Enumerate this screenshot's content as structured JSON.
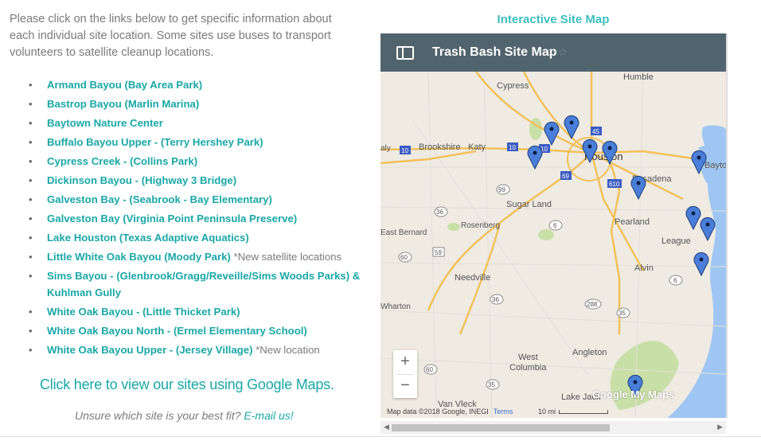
{
  "intro_text": "Please click on the links below to get specific information about each individual site location. Some sites use buses to transport volunteers to satellite cleanup locations.",
  "sites": [
    {
      "label": " Armand Bayou (Bay Area Park)",
      "note": ""
    },
    {
      "label": " Bastrop Bayou (Marlin Marina)",
      "note": ""
    },
    {
      "label": "Baytown Nature Center",
      "note": ""
    },
    {
      "label": "Buffalo Bayou Upper - (Terry Hershey Park)",
      "note": ""
    },
    {
      "label": "Cypress Creek - (Collins Park)",
      "note": ""
    },
    {
      "label": "Dickinson Bayou - (Highway 3 Bridge)",
      "note": ""
    },
    {
      "label": " Galveston Bay - (Seabrook - Bay Elementary)",
      "note": ""
    },
    {
      "label": "Galveston Bay (Virginia Point Peninsula Preserve)",
      "note": ""
    },
    {
      "label": "Lake Houston (Texas Adaptive Aquatics)",
      "note": ""
    },
    {
      "label": "Little White Oak Bayou (Moody Park)",
      "note": " *New satellite locations"
    },
    {
      "label": "Sims Bayou - (Glenbrook/Gragg/Reveille/Sims Woods Parks) & Kuhlman Gully",
      "note": ""
    },
    {
      "label": "White Oak Bayou - (Little Thicket Park)",
      "note": ""
    },
    {
      "label": "White Oak Bayou North - (Ermel Elementary School)",
      "note": ""
    },
    {
      "label": "White Oak Bayou Upper - (Jersey Village)",
      "note": " *New location"
    }
  ],
  "google_maps_link": "Click here to view our sites using Google Maps.",
  "unsure": {
    "text": "Unsure which site is your best fit? ",
    "link": "E-mail us!"
  },
  "map": {
    "section_title": "Interactive Site Map",
    "title": "Trash Bash Site Map",
    "star": "☆",
    "zoom_in": "+",
    "zoom_out": "−",
    "attribution": "Map data ©2018 Google, INEGI",
    "terms": "Terms",
    "scale": "10 mi",
    "logo": "Google My Maps",
    "places": [
      "Cypress",
      "Humble",
      "Brookshire",
      "Katy",
      "Houston",
      "Pasadena",
      "Baytown",
      "Sugar Land",
      "Rosenberg",
      "Pearland",
      "East Bernard",
      "League City",
      "Needville",
      "Alvin",
      "Wharton",
      "West Columbia",
      "Angleton",
      "Van Vleck",
      "Lake Jackson",
      "aly"
    ],
    "highway_labels": [
      "10",
      "10",
      "10",
      "69",
      "610",
      "99",
      "36",
      "59",
      "6",
      "60",
      "6",
      "36",
      "288",
      "35",
      "60",
      "35",
      "45"
    ],
    "colors": {
      "header": "#51646e",
      "marker": "#4a7ed8",
      "water": "#9fc6f2",
      "land": "#efeae2",
      "park": "#c9dfa8",
      "highway": "#f2c15a"
    }
  },
  "scrollbar": {
    "left_arrow": "◀",
    "right_arrow": "▶"
  }
}
